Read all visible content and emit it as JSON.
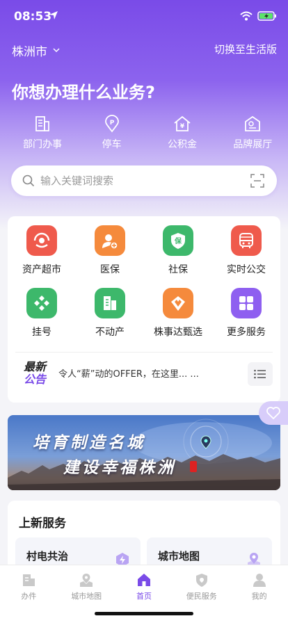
{
  "status": {
    "time": "08:53"
  },
  "header": {
    "city": "株洲市",
    "switch_label": "切换至生活版",
    "headline": "你想办理什么业务?"
  },
  "quick": [
    {
      "label": "部门办事",
      "icon": "department-icon"
    },
    {
      "label": "停车",
      "icon": "parking-icon"
    },
    {
      "label": "公积金",
      "icon": "housing-fund-icon"
    },
    {
      "label": "品牌展厅",
      "icon": "brand-hall-icon"
    }
  ],
  "search": {
    "placeholder": "输入关键词搜索"
  },
  "services": [
    {
      "label": "资产超市",
      "icon": "asset-market-icon",
      "color": "#ef5a4c"
    },
    {
      "label": "医保",
      "icon": "medical-insurance-icon",
      "color": "#f58a3c"
    },
    {
      "label": "社保",
      "icon": "social-security-icon",
      "color": "#3db86b"
    },
    {
      "label": "实时公交",
      "icon": "bus-icon",
      "color": "#ef5a4c"
    },
    {
      "label": "挂号",
      "icon": "registration-icon",
      "color": "#3db86b"
    },
    {
      "label": "不动产",
      "icon": "real-estate-icon",
      "color": "#3db86b"
    },
    {
      "label": "株事达甄选",
      "icon": "selection-icon",
      "color": "#f58a3c"
    },
    {
      "label": "更多服务",
      "icon": "more-services-icon",
      "color": "#8e5ff0"
    }
  ],
  "notice": {
    "logo_line1": "最新",
    "logo_line2": "公告",
    "text": "令人“薪”动的OFFER，在这里... ..."
  },
  "banner": {
    "line1": "培育制造名城",
    "line2": "建设幸福株洲"
  },
  "new_services": {
    "title": "上新服务",
    "items": [
      {
        "label": "村电共治",
        "icon": "power-icon"
      },
      {
        "label": "城市地图",
        "icon": "map-pin-icon"
      }
    ]
  },
  "tabs": [
    {
      "label": "办件",
      "icon": "files-icon",
      "active": false
    },
    {
      "label": "城市地图",
      "icon": "city-map-icon",
      "active": false
    },
    {
      "label": "首页",
      "icon": "home-icon",
      "active": true
    },
    {
      "label": "便民服务",
      "icon": "shield-icon",
      "active": false
    },
    {
      "label": "我的",
      "icon": "profile-icon",
      "active": false
    }
  ],
  "colors": {
    "accent": "#7a4be8",
    "tab_inactive": "#999999"
  }
}
